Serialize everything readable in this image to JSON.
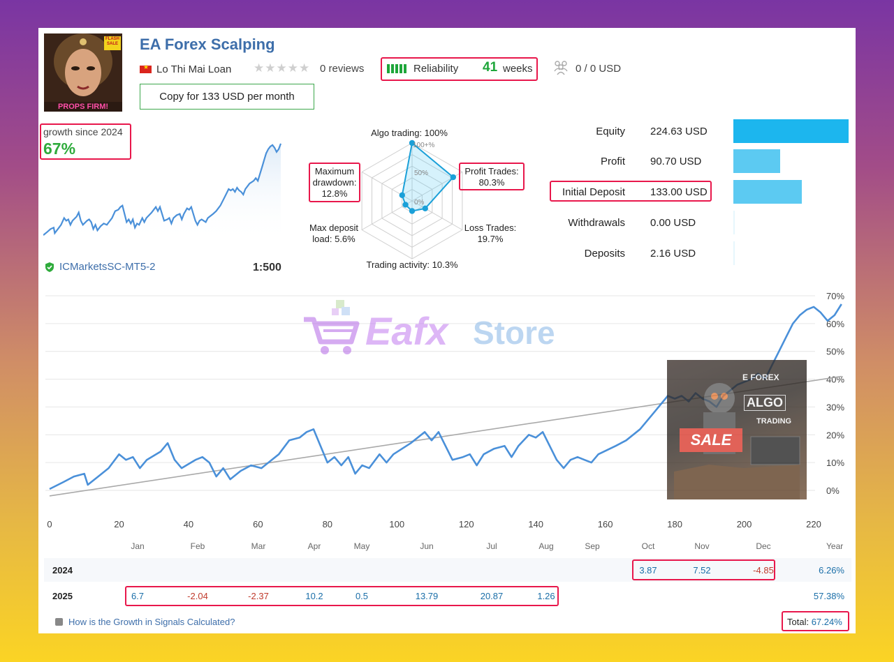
{
  "header": {
    "title": "EA Forex Scalping",
    "avatar_badge": "FLASH SALE",
    "avatar_caption": "PROPS FIRM!",
    "author": "Lo Thi Mai Loan",
    "reviews": "0 reviews",
    "reliability_label": "Reliability",
    "reliability_weeks": "41",
    "weeks_label": "weeks",
    "subscribers": "0 / 0 USD",
    "copy_button": "Copy for 133 USD per month"
  },
  "mini": {
    "growth_label": "growth since 2024",
    "growth_value": "67%",
    "broker": "ICMarketsSC-MT5-2",
    "leverage": "1:500"
  },
  "radar": {
    "algo": "Algo trading: 100%",
    "profit_l1": "Profit Trades:",
    "profit_l2": "80.3%",
    "loss_l1": "Loss Trades:",
    "loss_l2": "19.7%",
    "activity": "Trading activity: 10.3%",
    "deposit_l1": "Max deposit",
    "deposit_l2": "load: 5.6%",
    "dd_l1": "Maximum",
    "dd_l2": "drawdown:",
    "dd_l3": "12.8%",
    "tick_100": "100+%",
    "tick_50": "50%",
    "tick_0": "0%",
    "values": [
      1.0,
      0.803,
      0.197,
      0.103,
      0.056,
      0.128
    ]
  },
  "stats": [
    {
      "label": "Equity",
      "value": "224.63 USD",
      "amount": 224.63
    },
    {
      "label": "Profit",
      "value": "90.70 USD",
      "amount": 90.7
    },
    {
      "label": "Initial Deposit",
      "value": "133.00 USD",
      "amount": 133.0
    },
    {
      "label": "Withdrawals",
      "value": "0.00 USD",
      "amount": 0.0
    },
    {
      "label": "Deposits",
      "value": "2.16 USD",
      "amount": 2.16
    }
  ],
  "watermark": {
    "brand": "Eafx",
    "brand2": "Store",
    "ad_text_1": "E FOREX",
    "ad_text_2": "ALGO",
    "ad_text_3": "TRADING",
    "ad_sale": "SALE"
  },
  "chart_data": {
    "type": "line",
    "x_ticks": [
      "0",
      "20",
      "40",
      "60",
      "80",
      "100",
      "120",
      "140",
      "160",
      "180",
      "200",
      "220"
    ],
    "y_ticks": [
      "70%",
      "60%",
      "50%",
      "40%",
      "30%",
      "20%",
      "10%",
      "0%"
    ],
    "xlim": [
      0,
      220
    ],
    "ylim": [
      0,
      70
    ],
    "grid": true,
    "series": [
      {
        "values": [
          [
            0,
            0.5
          ],
          [
            4,
            3
          ],
          [
            7,
            5
          ],
          [
            10,
            6
          ],
          [
            11,
            2
          ],
          [
            14,
            5
          ],
          [
            17,
            8
          ],
          [
            20,
            13
          ],
          [
            22,
            11
          ],
          [
            24,
            12
          ],
          [
            26,
            8
          ],
          [
            28,
            11
          ],
          [
            32,
            14
          ],
          [
            34,
            17
          ],
          [
            36,
            11
          ],
          [
            38,
            8
          ],
          [
            42,
            11
          ],
          [
            44,
            12
          ],
          [
            46,
            10
          ],
          [
            48,
            5
          ],
          [
            50,
            8
          ],
          [
            52,
            4
          ],
          [
            55,
            7
          ],
          [
            58,
            9
          ],
          [
            61,
            8
          ],
          [
            63,
            10
          ],
          [
            66,
            13
          ],
          [
            69,
            18
          ],
          [
            72,
            19
          ],
          [
            74,
            21
          ],
          [
            76,
            22
          ],
          [
            80,
            10
          ],
          [
            82,
            12
          ],
          [
            84,
            9
          ],
          [
            86,
            12
          ],
          [
            88,
            6
          ],
          [
            90,
            9
          ],
          [
            92,
            8
          ],
          [
            95,
            13
          ],
          [
            97,
            10
          ],
          [
            99,
            13
          ],
          [
            104,
            17
          ],
          [
            108,
            21
          ],
          [
            110,
            18
          ],
          [
            112,
            21
          ],
          [
            116,
            11
          ],
          [
            119,
            12
          ],
          [
            121,
            13
          ],
          [
            123,
            9
          ],
          [
            125,
            13
          ],
          [
            128,
            15
          ],
          [
            131,
            16
          ],
          [
            133,
            12
          ],
          [
            135,
            16
          ],
          [
            138,
            20
          ],
          [
            140,
            19
          ],
          [
            142,
            21
          ],
          [
            146,
            11
          ],
          [
            148,
            8
          ],
          [
            150,
            11
          ],
          [
            152,
            12
          ],
          [
            154,
            11
          ],
          [
            156,
            10
          ],
          [
            158,
            13
          ],
          [
            163,
            16
          ],
          [
            166,
            18
          ],
          [
            170,
            22
          ],
          [
            174,
            28
          ],
          [
            178,
            34
          ],
          [
            180,
            33
          ],
          [
            182,
            34
          ],
          [
            184,
            32
          ],
          [
            186,
            35
          ],
          [
            188,
            33
          ],
          [
            190,
            32
          ],
          [
            192,
            30
          ],
          [
            194,
            34
          ],
          [
            196,
            36
          ],
          [
            198,
            38
          ],
          [
            200,
            39
          ],
          [
            202,
            40
          ],
          [
            204,
            42
          ],
          [
            206,
            40
          ],
          [
            208,
            45
          ],
          [
            210,
            50
          ],
          [
            212,
            55
          ],
          [
            214,
            60
          ],
          [
            216,
            63
          ],
          [
            218,
            65
          ],
          [
            220,
            66
          ],
          [
            222,
            64
          ],
          [
            224,
            61
          ],
          [
            226,
            63
          ],
          [
            228,
            67
          ]
        ]
      },
      {
        "values": [
          [
            0,
            -2
          ],
          [
            228,
            41
          ]
        ]
      }
    ]
  },
  "monthly": {
    "months": [
      "Jan",
      "Feb",
      "Mar",
      "Apr",
      "May",
      "Jun",
      "Jul",
      "Aug",
      "Sep",
      "Oct",
      "Nov",
      "Dec"
    ],
    "year_header": "Year",
    "rows": [
      {
        "year": "2024",
        "cells": [
          "",
          "",
          "",
          "",
          "",
          "",
          "",
          "",
          "",
          "3.87",
          "7.52",
          "-4.85"
        ],
        "total": "6.26%"
      },
      {
        "year": "2025",
        "cells": [
          "6.7",
          "-2.04",
          "-2.37",
          "10.2",
          "0.5",
          "13.79",
          "20.87",
          "1.26",
          "",
          "",
          "",
          ""
        ],
        "total": "57.38%"
      }
    ],
    "faq": "How is the Growth in Signals Calculated?",
    "total_label": "Total:",
    "total_value": "67.24%"
  },
  "colors": {
    "accent": "#3d6eaa",
    "green": "#1ea63a",
    "line": "#4a90d9",
    "highlight": "#e8174b",
    "bar": "#5ccaf2"
  }
}
